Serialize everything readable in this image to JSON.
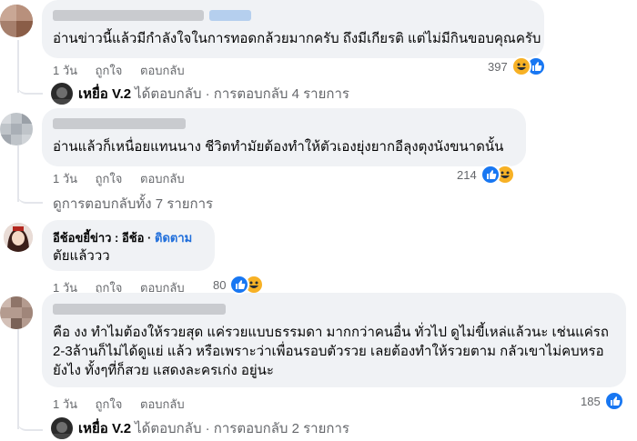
{
  "comments": [
    {
      "text": "อ่านข่าวนี้แล้วมีกำลังใจในการทอดกล้วยมากครับ ถึงมีเกียรติ แต่ไม่มีกินขอบคุณครับ",
      "time": "1 วัน",
      "like": "ถูกใจ",
      "reply": "ตอบกลับ",
      "reaction_count": "397",
      "reactions": [
        "haha-icon",
        "like-icon"
      ],
      "replies": {
        "author": "เหยื่อ V.2",
        "text": "ได้ตอบกลับ · การตอบกลับ 4 รายการ"
      }
    },
    {
      "text": "อ่านแล้วก็เหนื่อยแทนนาง ชีวิตทำมัยต้องทำให้ตัวเองยุ่งยากอีลุงตุงนังขนาดนั้น",
      "time": "1 วัน",
      "like": "ถูกใจ",
      "reply": "ตอบกลับ",
      "reaction_count": "214",
      "reactions": [
        "like-icon",
        "haha-icon"
      ],
      "replies": {
        "text": "ดูการตอบกลับทั้ง 7 รายการ"
      }
    },
    {
      "author": "อีช้อขยี้ข่าว : อีช้อ",
      "follow": "ติดตาม",
      "text": "ตัยแล้ววว",
      "time": "1 วัน",
      "like": "ถูกใจ",
      "reply": "ตอบกลับ",
      "reaction_count": "80",
      "reactions": [
        "like-icon",
        "haha-icon"
      ]
    },
    {
      "text_lines": [
        "คือ งง ทำไมต้องให้รวยสุด แค่รวยแบบธรรมดา มากกว่าคนอื่น ทั่วไป ดูไม่ขี้เหล่แล้วนะ เช่นแค่รถ",
        "2-3ล้านก็ไม่ได้ดูแย่ แล้ว หรือเพราะว่าเพื่อนรอบตัวรวย เลยต้องทำให้รวยตาม กลัวเขาไม่คบหรอ",
        "ยังไง ทั้งๆที่ก็สวย แสดงละครเก่ง อยู่นะ"
      ],
      "time": "1 วัน",
      "like": "ถูกใจ",
      "reply": "ตอบกลับ",
      "reaction_count": "185",
      "reactions": [
        "like-icon"
      ],
      "replies": {
        "author": "เหยื่อ V.2",
        "text": "ได้ตอบกลับ · การตอบกลับ 2 รายการ"
      }
    }
  ],
  "colors": {
    "bubble": "#f0f2f5",
    "link_blue": "#216fdb",
    "meta_gray": "#65676b",
    "like_blue": "#1877f2",
    "haha_yellow": "#f7b125"
  }
}
